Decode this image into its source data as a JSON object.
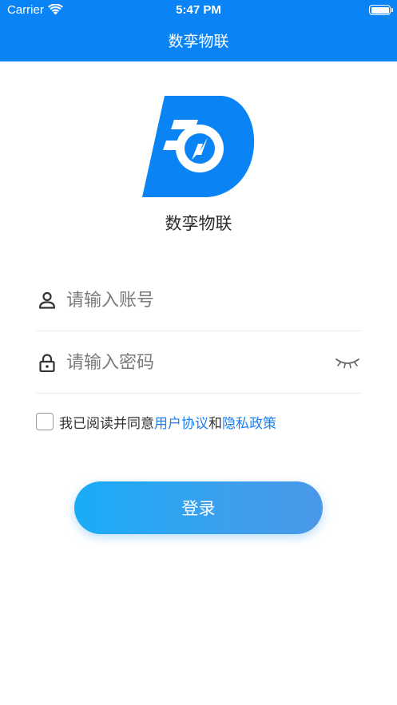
{
  "status_bar": {
    "carrier": "Carrier",
    "time": "5:47 PM"
  },
  "header": {
    "title": "数孪物联"
  },
  "logo": {
    "name": "数孪物联",
    "color": "#0a84f5"
  },
  "login_form": {
    "username_placeholder": "请输入账号",
    "password_placeholder": "请输入密码",
    "agreement_prefix": "我已阅读并同意",
    "user_agreement_link": "用户协议",
    "conjunction": "和",
    "privacy_policy_link": "隐私政策",
    "agreement_checked": false,
    "login_label": "登录"
  },
  "colors": {
    "primary": "#0a84f5",
    "link": "#1a7ff2",
    "button_gradient_start": "#19acf7",
    "button_gradient_end": "#4a98e8"
  },
  "icons": {
    "username": "person-icon",
    "password": "lock-icon",
    "toggle_password": "eye-closed-icon"
  }
}
